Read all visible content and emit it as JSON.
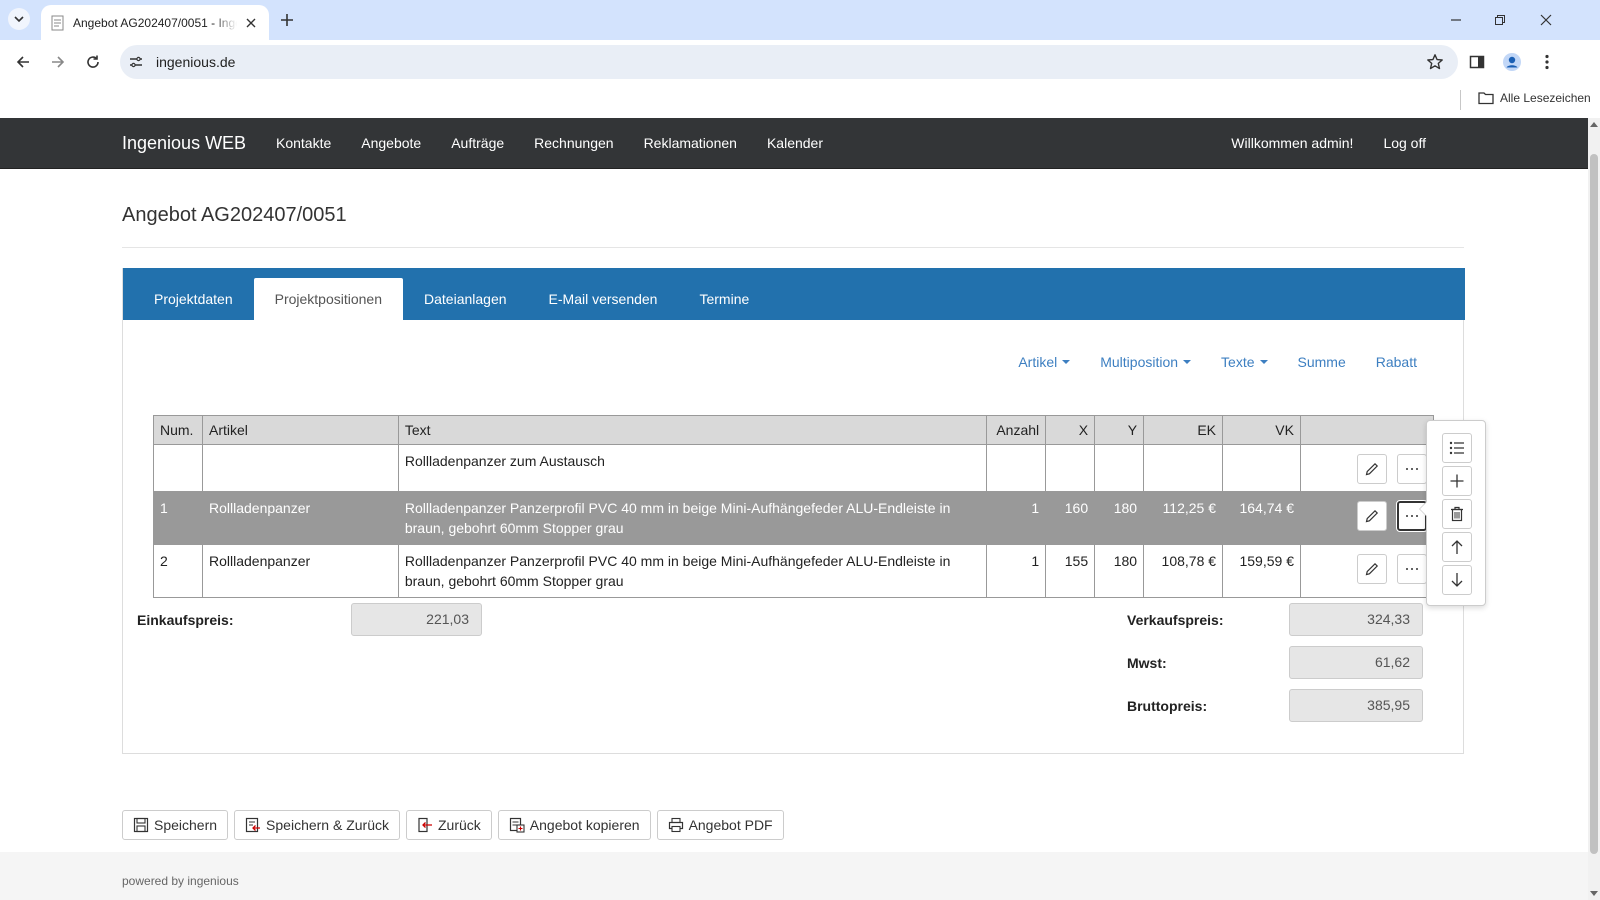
{
  "browser": {
    "tab_title": "Angebot AG202407/0051 - Ingenious WEB",
    "url": "ingenious.de",
    "bookmarks_all": "Alle Lesezeichen"
  },
  "navbar": {
    "brand": "Ingenious WEB",
    "links": [
      "Kontakte",
      "Angebote",
      "Aufträge",
      "Rechnungen",
      "Reklamationen",
      "Kalender"
    ],
    "welcome": "Willkommen admin!",
    "logoff": "Log off"
  },
  "page": {
    "title": "Angebot AG202407/0051"
  },
  "tabs": {
    "items": [
      "Projektdaten",
      "Projektpositionen",
      "Dateianlagen",
      "E-Mail versenden",
      "Termine"
    ],
    "active": "Projektpositionen"
  },
  "actions": {
    "artikel": "Artikel",
    "multiposition": "Multiposition",
    "texte": "Texte",
    "summe": "Summe",
    "rabatt": "Rabatt"
  },
  "table": {
    "headers": [
      "Num.",
      "Artikel",
      "Text",
      "Anzahl",
      "X",
      "Y",
      "EK",
      "VK",
      ""
    ],
    "rows": [
      {
        "num": "",
        "artikel": "",
        "text": "Rollladenpanzer zum Austausch",
        "anzahl": "",
        "x": "",
        "y": "",
        "ek": "",
        "vk": "",
        "selected": false
      },
      {
        "num": "1",
        "artikel": "Rollladenpanzer",
        "text": "Rollladenpanzer Panzerprofil PVC 40 mm in beige Mini-Aufhängefeder ALU-Endleiste in braun, gebohrt 60mm Stopper grau",
        "anzahl": "1",
        "x": "160",
        "y": "180",
        "ek": "112,25 €",
        "vk": "164,74 €",
        "selected": true
      },
      {
        "num": "2",
        "artikel": "Rollladenpanzer",
        "text": "Rollladenpanzer Panzerprofil PVC 40 mm in beige Mini-Aufhängefeder ALU-Endleiste in braun, gebohrt 60mm Stopper grau",
        "anzahl": "1",
        "x": "155",
        "y": "180",
        "ek": "108,78 €",
        "vk": "159,59 €",
        "selected": false
      }
    ]
  },
  "popover": {
    "icons": [
      "list-icon",
      "plus-icon",
      "trash-icon",
      "arrow-up-icon",
      "arrow-down-icon"
    ]
  },
  "sums": {
    "einkauf_label": "Einkaufspreis:",
    "einkauf_value": "221,03",
    "verkauf_label": "Verkaufspreis:",
    "verkauf_value": "324,33",
    "mwst_label": "Mwst:",
    "mwst_value": "61,62",
    "brutto_label": "Bruttopreis:",
    "brutto_value": "385,95"
  },
  "buttons": {
    "speichern": "Speichern",
    "speichern_zurueck": "Speichern & Zurück",
    "zurueck": "Zurück",
    "kopieren": "Angebot kopieren",
    "pdf": "Angebot PDF"
  },
  "footer": {
    "text": "powered by ingenious"
  },
  "colors": {
    "navbar_bg": "#333537",
    "tab_bar_bg": "#2271ad",
    "link_blue": "#3d7fc1",
    "selected_row_bg": "#999999",
    "field_bg": "#e6e6e6"
  }
}
